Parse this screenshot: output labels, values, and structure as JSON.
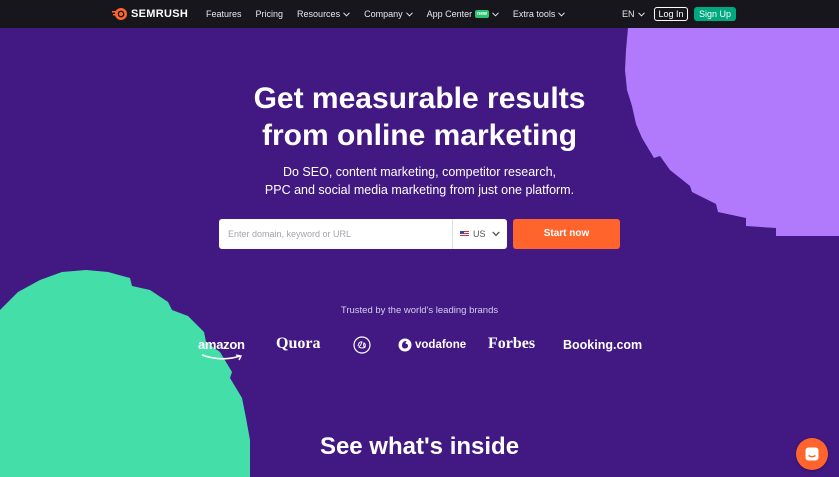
{
  "brand": {
    "name": "SEMRUSH",
    "icon": "semrush-fireball-logo"
  },
  "nav": {
    "items": [
      {
        "label": "Features",
        "dropdown": false
      },
      {
        "label": "Pricing",
        "dropdown": false
      },
      {
        "label": "Resources",
        "dropdown": true
      },
      {
        "label": "Company",
        "dropdown": true
      },
      {
        "label": "App Center",
        "dropdown": true,
        "badge": "new"
      },
      {
        "label": "Extra tools",
        "dropdown": true
      }
    ],
    "language": "EN",
    "login_label": "Log In",
    "signup_label": "Sign Up"
  },
  "hero": {
    "headline_line1": "Get measurable results",
    "headline_line2": "from online marketing",
    "subhead_line1": "Do SEO, content marketing, competitor research,",
    "subhead_line2": "PPC and social media marketing from just one platform.",
    "search_placeholder": "Enter domain, keyword or URL",
    "country": "US",
    "cta_label": "Start now"
  },
  "trusted": {
    "label": "Trusted by the world's leading brands",
    "brands": [
      "amazon",
      "Quora",
      "GE",
      "vodafone",
      "Forbes",
      "Booking.com"
    ]
  },
  "section_title": "See what's inside",
  "colors": {
    "background": "#421983",
    "topbar": "#16161c",
    "accent_orange": "#ff642d",
    "signup_green": "#00a97f",
    "shape_purple": "#b179fb",
    "shape_green": "#44dfa9"
  }
}
